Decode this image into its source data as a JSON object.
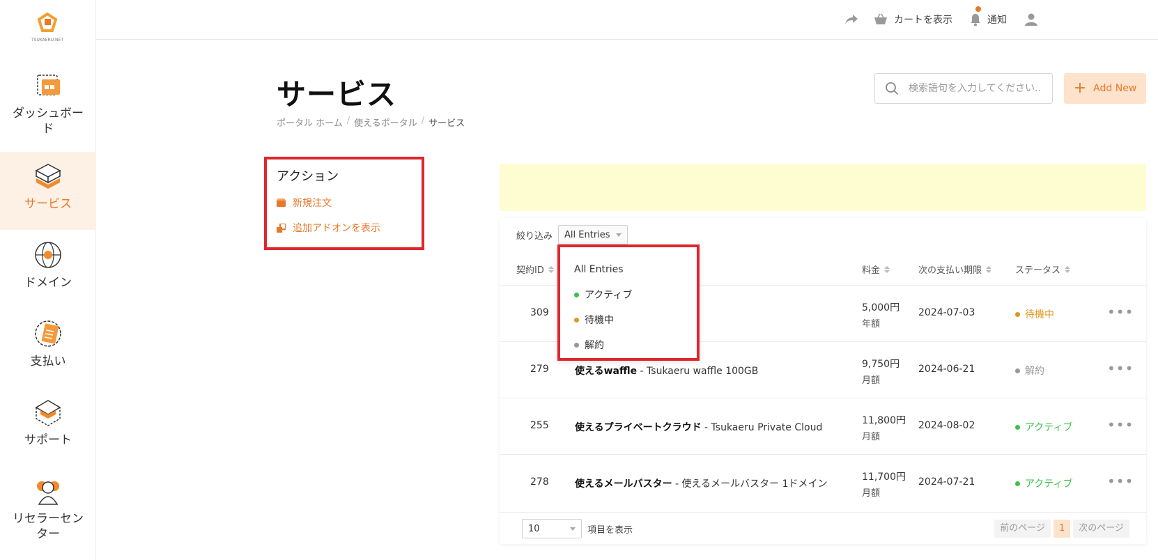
{
  "logo": {
    "text": "TSUKAERU.NET"
  },
  "sidebar": {
    "items": [
      {
        "label": "ダッシュボード",
        "icon": "dashboard-icon"
      },
      {
        "label": "サービス",
        "icon": "services-icon",
        "active": true
      },
      {
        "label": "ドメイン",
        "icon": "globe-icon"
      },
      {
        "label": "支払い",
        "icon": "billing-icon"
      },
      {
        "label": "サポート",
        "icon": "support-icon"
      },
      {
        "label": "リセラーセンター",
        "icon": "reseller-icon"
      }
    ]
  },
  "topbar": {
    "share_icon": "share-icon",
    "cart_label": "カートを表示",
    "notifications_label": "通知",
    "user_icon": "user-icon"
  },
  "page": {
    "title": "サービス",
    "breadcrumb": [
      "ポータル ホーム",
      "使えるポータル",
      "サービス"
    ]
  },
  "search": {
    "placeholder": "検索語句を入力してください..."
  },
  "add_new": {
    "label": "Add New"
  },
  "actions": {
    "title": "アクション",
    "items": [
      "新規注文",
      "追加アドオンを表示"
    ]
  },
  "filter": {
    "label": "絞り込み",
    "selected": "All Entries",
    "options": [
      {
        "label": "All Entries",
        "color": ""
      },
      {
        "label": "アクティブ",
        "color": "#3cc14a"
      },
      {
        "label": "待機中",
        "color": "#e0961f"
      },
      {
        "label": "解約",
        "color": "#999999"
      }
    ]
  },
  "table": {
    "headers": {
      "id": "契約ID",
      "price": "料金",
      "next_due": "次の支払い期限",
      "status": "ステータス"
    },
    "rows": [
      {
        "id": "309",
        "product_bold": "",
        "product_rest": "",
        "price": "5,000円",
        "cycle": "年額",
        "date": "2024-07-03",
        "status": "待機中",
        "status_color": "#e0961f"
      },
      {
        "id": "279",
        "product_bold": "使えるwaffle",
        "product_rest": " - Tsukaeru waffle 100GB",
        "price": "9,750円",
        "cycle": "月額",
        "date": "2024-06-21",
        "status": "解約",
        "status_color": "#999999"
      },
      {
        "id": "255",
        "product_bold": "使えるプライベートクラウド",
        "product_rest": " - Tsukaeru Private Cloud",
        "price": "11,800円",
        "cycle": "月額",
        "date": "2024-08-02",
        "status": "アクティブ",
        "status_color": "#3cc14a"
      },
      {
        "id": "278",
        "product_bold": "使えるメールバスター",
        "product_rest": " - 使えるメールバスター 1ドメイン",
        "price": "11,700円",
        "cycle": "月額",
        "date": "2024-07-21",
        "status": "アクティブ",
        "status_color": "#3cc14a"
      }
    ]
  },
  "footer": {
    "page_size": "10",
    "page_size_label": "項目を表示",
    "prev": "前のページ",
    "current_page": "1",
    "next": "次のページ"
  },
  "colors": {
    "accent": "#e8782a",
    "highlight_border": "#e0262d",
    "notice_bg": "#fefdd2"
  }
}
